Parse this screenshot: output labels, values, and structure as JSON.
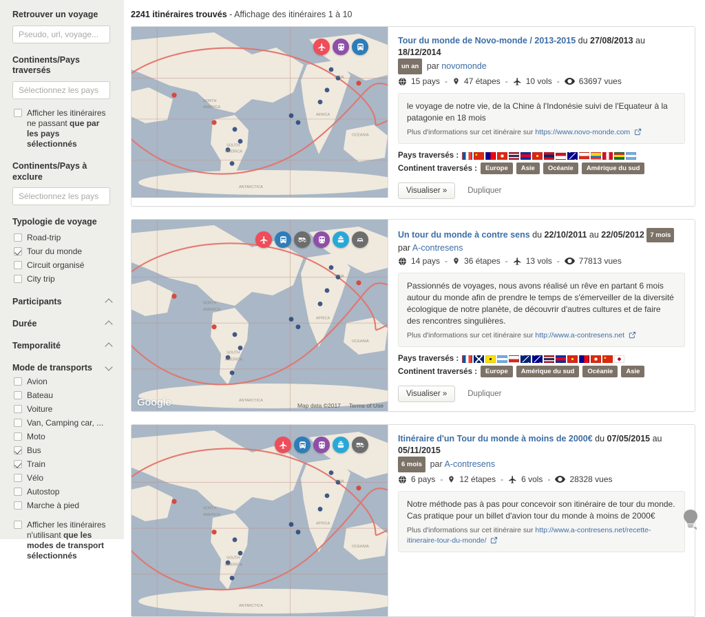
{
  "sidebar": {
    "search": {
      "heading": "Retrouver un voyage",
      "placeholder": "Pseudo, url, voyage..."
    },
    "countries_included": {
      "heading": "Continents/Pays traversés",
      "placeholder": "Sélectionnez les pays"
    },
    "only_selected": {
      "part1": "Afficher les itinéraires ne passant ",
      "strong": "que par les pays sélectionnés",
      "checked": false
    },
    "countries_excluded": {
      "heading": "Continents/Pays à exclure",
      "placeholder": "Sélectionnez les pays"
    },
    "typology": {
      "heading": "Typologie de voyage",
      "items": [
        {
          "label": "Road-trip",
          "checked": false
        },
        {
          "label": "Tour du monde",
          "checked": true
        },
        {
          "label": "Circuit organisé",
          "checked": false
        },
        {
          "label": "City trip",
          "checked": false
        }
      ]
    },
    "accordions": [
      {
        "label": "Participants",
        "state": "up"
      },
      {
        "label": "Durée",
        "state": "up"
      },
      {
        "label": "Temporalité",
        "state": "up"
      }
    ],
    "transports": {
      "heading": "Mode de transports",
      "state": "down",
      "items": [
        {
          "label": "Avion",
          "checked": false
        },
        {
          "label": "Bateau",
          "checked": false
        },
        {
          "label": "Voiture",
          "checked": false
        },
        {
          "label": "Van, Camping car, ...",
          "checked": false
        },
        {
          "label": "Moto",
          "checked": false
        },
        {
          "label": "Bus",
          "checked": true
        },
        {
          "label": "Train",
          "checked": true
        },
        {
          "label": "Vélo",
          "checked": false
        },
        {
          "label": "Autostop",
          "checked": false
        },
        {
          "label": "Marche à pied",
          "checked": false
        }
      ]
    },
    "only_selected_transports": {
      "part1": "Afficher les itinéraires n'utilisant ",
      "strong": "que les modes de transport sélectionnés",
      "checked": false
    }
  },
  "results": {
    "count_label": "2241 itinéraires trouvés",
    "range_label": " - Affichage des itinéraires 1 à 10"
  },
  "common": {
    "pays_traverses_label": "Pays traversés :",
    "continent_traverses_label": "Continent traversés :",
    "more_info_prefix": "Plus d'informations sur cet itinéraire sur ",
    "visualiser_label": "Visualiser »",
    "dupliquer_label": "Dupliquer",
    "du_label": "du",
    "au_label": "au",
    "par_label": "par",
    "map_logo": "Google",
    "map_attr": "Map data ©2017",
    "map_terms": "Terms of Use"
  },
  "cards": [
    {
      "title": "Tour du monde de Novo-monde / 2013-2015",
      "date_start": "27/08/2013",
      "date_end": "18/12/2014",
      "duration": "un an",
      "duration_position": "after_author_line",
      "author": "novomonde",
      "stats": {
        "pays": "15 pays",
        "etapes": "47 étapes",
        "vols": "10 vols",
        "vues": "63697 vues"
      },
      "description": "le voyage de notre vie, de la Chine à l'Indonésie suivi de l'Equateur à la patagonie en 18 mois",
      "link": "https://www.novo-monde.com",
      "modes": [
        "avion",
        "train",
        "bus"
      ],
      "flags": [
        "FR",
        "CN",
        "TW",
        "HK",
        "TH",
        "KH",
        "VN",
        "LA",
        "ID",
        "AU",
        "CL",
        "EC",
        "PE",
        "BO",
        "AR"
      ],
      "continents": [
        "Europe",
        "Asie",
        "Océanie",
        "Amérique du sud"
      ]
    },
    {
      "title": "Un tour du monde à contre sens",
      "date_start": "22/10/2011",
      "date_end": "22/05/2012",
      "duration": "7 mois",
      "duration_position": "inline",
      "author": "A-contresens",
      "stats": {
        "pays": "14 pays",
        "etapes": "36 étapes",
        "vols": "13 vols",
        "vues": "77813 vues"
      },
      "description": "Passionnés de voyages, nous avons réalisé un rêve en partant 6 mois autour du monde afin de prendre le temps de s'émerveiller de la diversité écologique de notre planète, de découvrir d'autres cultures et de faire des rencontres singulières.",
      "link": "http://www.a-contresens.net",
      "modes": [
        "avion",
        "bus",
        "van",
        "train",
        "bateau",
        "voiture"
      ],
      "flags": [
        "FR",
        "GB",
        "BR",
        "AR",
        "CL",
        "NZ",
        "AU",
        "TH",
        "KH",
        "VN",
        "TW",
        "HK",
        "CN",
        "JP"
      ],
      "continents": [
        "Europe",
        "Amérique du sud",
        "Océanie",
        "Asie"
      ]
    },
    {
      "title": "Itinéraire d'un Tour du monde à moins de 2000€",
      "date_start": "07/05/2015",
      "date_end": "05/11/2015",
      "duration": "6 mois",
      "duration_position": "after_author_line",
      "author": "A-contresens",
      "stats": {
        "pays": "6 pays",
        "etapes": "12 étapes",
        "vols": "6 vols",
        "vues": "28328 vues"
      },
      "description": "Notre méthode pas à pas pour concevoir son itinéraire de tour du monde. Cas pratique pour un billet d'avion tour du monde à moins de 2000€",
      "link": "http://www.a-contresens.net/recette-itineraire-tour-du-monde/",
      "modes": [
        "avion",
        "bus",
        "train",
        "bateau",
        "van"
      ],
      "flags": [],
      "continents": []
    }
  ],
  "icons": {
    "globe": "globe-icon",
    "pin": "pin-icon",
    "plane": "plane-icon",
    "eye": "eye-icon",
    "external": "external-link-icon",
    "lightbulb": "lightbulb-icon"
  }
}
